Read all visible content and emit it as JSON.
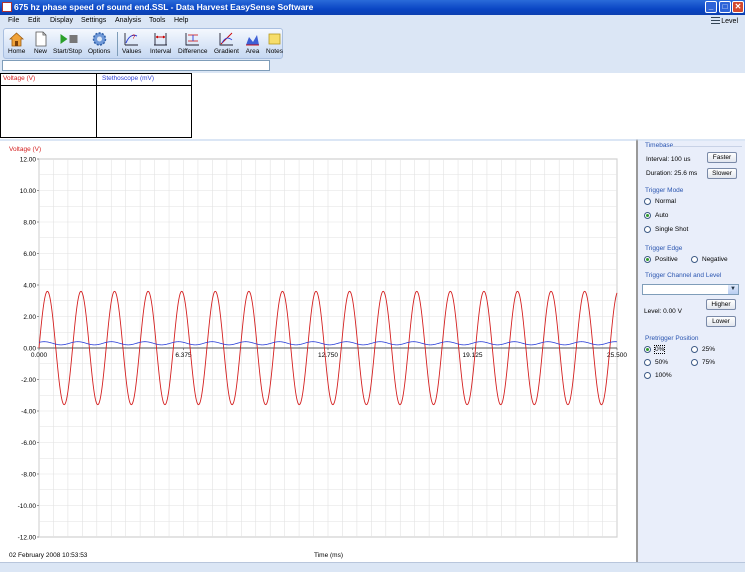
{
  "window": {
    "title": "675 hz phase speed of sound end.SSL - Data Harvest EasySense Software",
    "buttons": {
      "minimize": "_",
      "maximize": "□",
      "close": "✕"
    }
  },
  "menu": {
    "items": [
      "File",
      "Edit",
      "Display",
      "Settings",
      "Analysis",
      "Tools",
      "Help"
    ],
    "level_label": "Level"
  },
  "toolbar": {
    "home": "Home",
    "new": "New",
    "start_stop": "Start/Stop",
    "options": "Options",
    "values": "Values",
    "interval": "Interval",
    "difference": "Difference",
    "gradient": "Gradient",
    "area": "Area",
    "notes": "Notes"
  },
  "meters": {
    "voltage_label": "Voltage (V)",
    "stethoscope_label": "Stethoscope (mV)"
  },
  "chart_data": {
    "type": "line",
    "ylabel": "Voltage (V)",
    "xlabel": "Time (ms)",
    "timestamp": "02 February 2008  10:53:53",
    "xlim": [
      0,
      25.5
    ],
    "ylim": [
      -12,
      12
    ],
    "y_ticks": [
      "12.00",
      "10.00",
      "8.00",
      "6.00",
      "4.00",
      "2.00",
      "0.00",
      "-2.00",
      "-4.00",
      "-6.00",
      "-8.00",
      "-10.00",
      "-12.00"
    ],
    "x_ticks": [
      "0.000",
      "6.375",
      "12.750",
      "19.125",
      "25.500"
    ],
    "grid": true,
    "series": [
      {
        "color": "#d42020",
        "frequency_hz": 675,
        "amplitude": 3.6,
        "offset": 0.0
      },
      {
        "color": "#2b3fd8",
        "frequency_hz": 675,
        "amplitude": 0.1,
        "offset": 0.3
      }
    ]
  },
  "timebase": {
    "title": "Timebase",
    "interval": "Interval:  100 us",
    "duration": "Duration:  25.6 ms",
    "faster": "Faster",
    "slower": "Slower"
  },
  "trigger_mode": {
    "title": "Trigger Mode",
    "options": [
      "Normal",
      "Auto",
      "Single Shot"
    ],
    "selected": "Auto"
  },
  "trigger_edge": {
    "title": "Trigger Edge",
    "positive": "Positive",
    "negative": "Negative",
    "selected": "Positive"
  },
  "trigger_channel": {
    "title": "Trigger Channel and Level",
    "level": "Level:  0.00 V",
    "higher": "Higher",
    "lower": "Lower"
  },
  "pretrigger": {
    "title": "Pretrigger Position",
    "options": [
      "0%",
      "25%",
      "50%",
      "75%",
      "100%"
    ],
    "selected": "0%"
  },
  "colors": {
    "accent": "#0a46c4",
    "panel_bg": "#dbe6f5",
    "red_series": "#d42020",
    "blue_series": "#2b3fd8"
  }
}
